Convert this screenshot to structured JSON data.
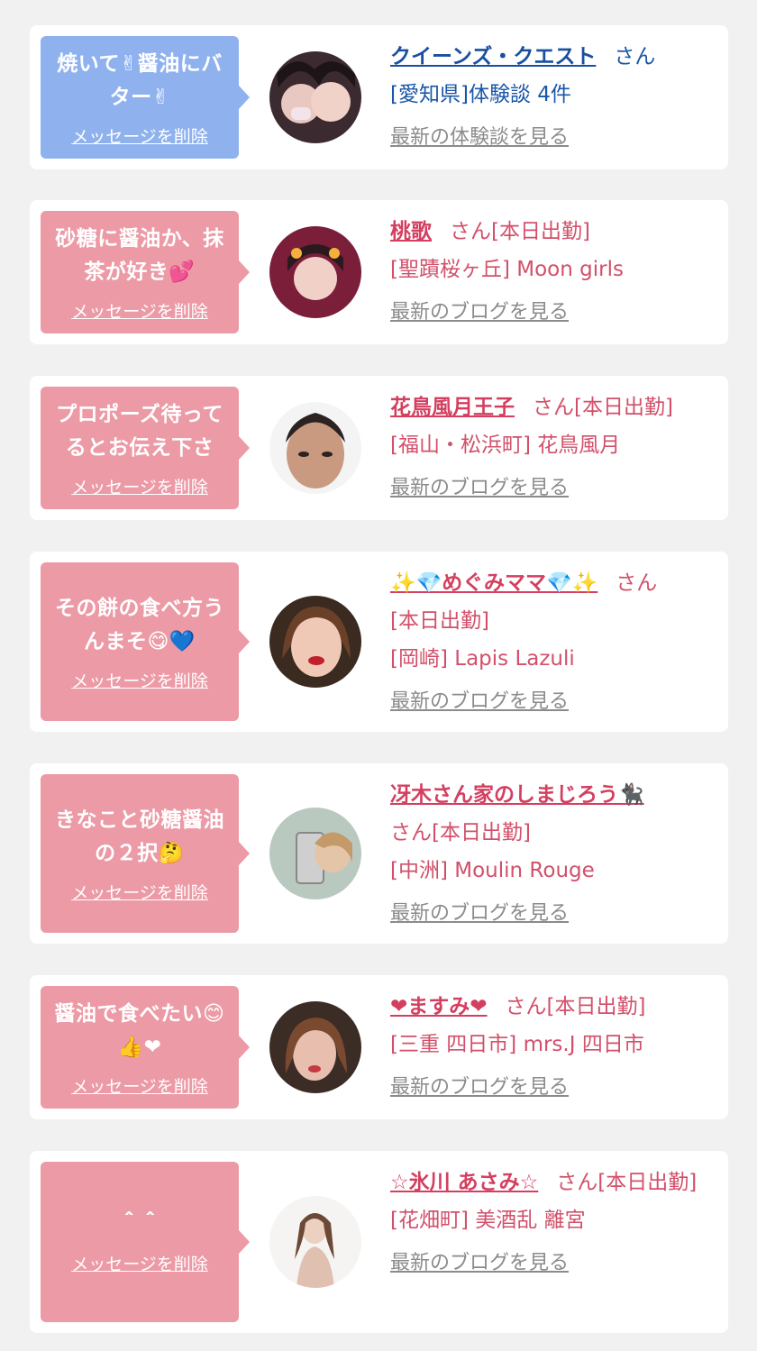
{
  "delete_label": "メッセージを削除",
  "cards": [
    {
      "message": "焼いて✌醤油にバター✌",
      "name": "クイーンズ・クエスト",
      "suffix": "さん",
      "line2": "[愛知県]体験談 4件",
      "line3": "",
      "link": "最新の体験談を見る",
      "theme": "blue"
    },
    {
      "message": "砂糖に醤油か、抹茶が好き💕",
      "name": "桃歌",
      "suffix": "さん[本日出勤]",
      "line2": "[聖蹟桜ヶ丘] Moon girls",
      "line3": "",
      "link": "最新のブログを見る",
      "theme": "pink"
    },
    {
      "message": "プロポーズ待ってるとお伝え下さ",
      "name": "花鳥風月王子",
      "suffix": "さん[本日出勤]",
      "line2": "[福山・松浜町] 花鳥風月",
      "line3": "",
      "link": "最新のブログを見る",
      "theme": "pink"
    },
    {
      "message": "その餅の食べ方うんまそ😋💙",
      "name": "✨💎めぐみママ💎✨",
      "suffix": "さん",
      "line2": "[本日出勤]",
      "line3": "[岡崎] Lapis Lazuli",
      "link": "最新のブログを見る",
      "theme": "pink"
    },
    {
      "message": "きなこと砂糖醤油の２択🤔",
      "name": "冴木さん家のしまじろう🐈‍⬛",
      "suffix": "さん[本日出勤]",
      "line2": "[中洲] Moulin Rouge",
      "line3": "",
      "link": "最新のブログを見る",
      "theme": "pink"
    },
    {
      "message": "醤油で食べたい😊👍❤",
      "name": "❤ますみ❤",
      "suffix": "さん[本日出勤]",
      "line2": "[三重 四日市] mrs.J 四日市",
      "line3": "",
      "link": "最新のブログを見る",
      "theme": "pink"
    },
    {
      "message": "＾＾",
      "name": "☆氷川 あさみ☆",
      "suffix": "さん[本日出勤]",
      "line2": "[花畑町] 美酒乱 離宮",
      "line3": "",
      "link": "最新のブログを見る",
      "theme": "pink"
    }
  ]
}
